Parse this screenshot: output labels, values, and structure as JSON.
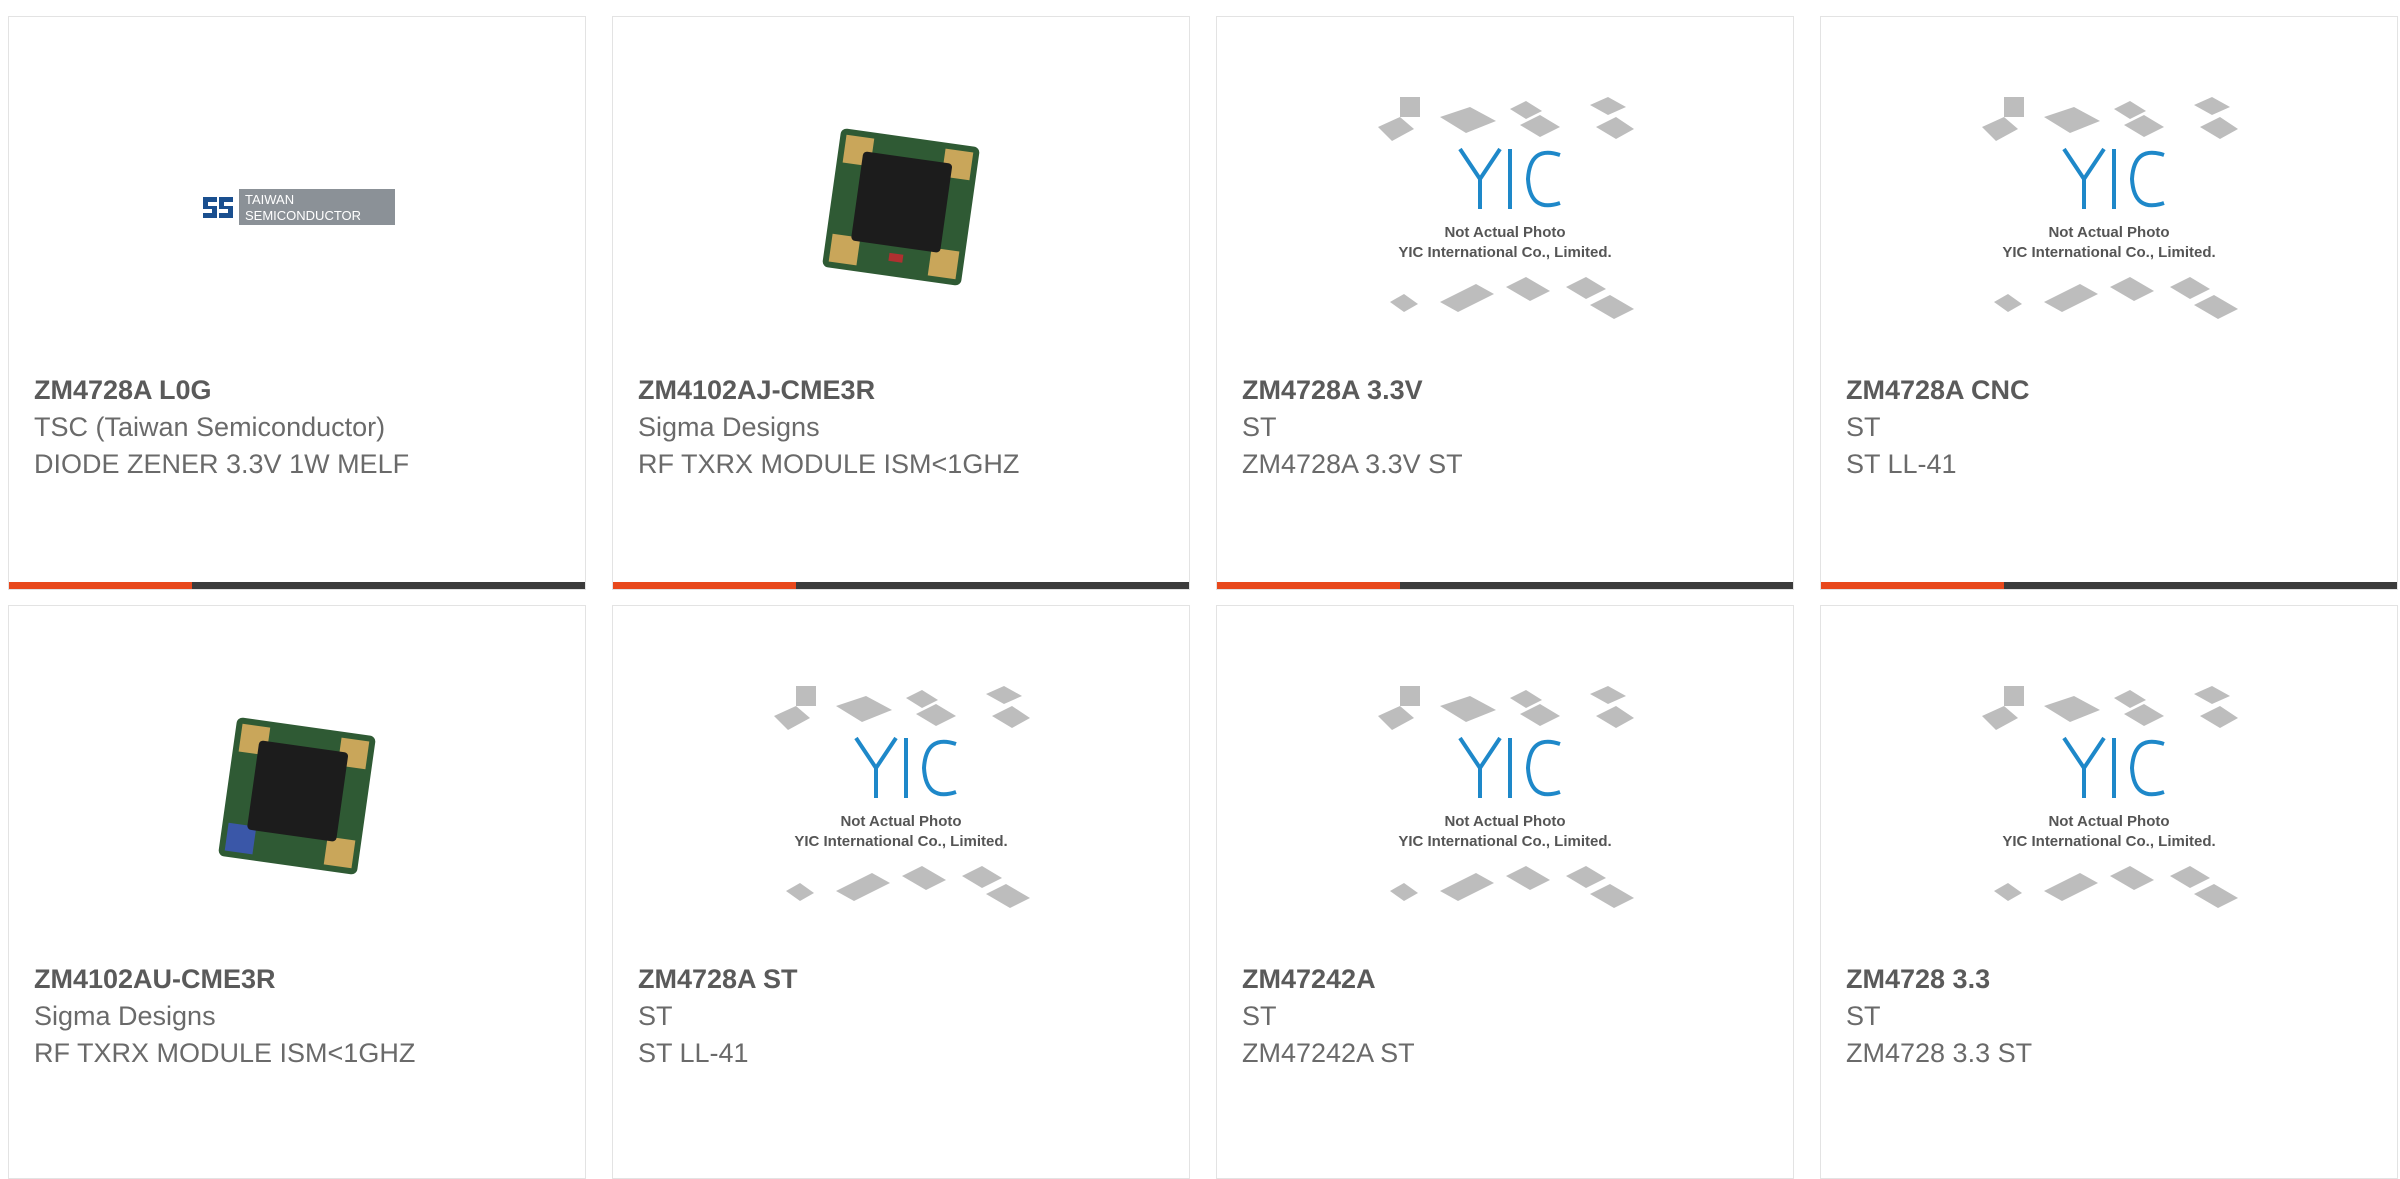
{
  "colors": {
    "accent": "#e8481c",
    "bar": "#3b3b3b",
    "text_bold": "#5a5a5a",
    "text": "#6a6a6a"
  },
  "placeholder": {
    "line1": "Not Actual Photo",
    "line2": "YIC International Co., Limited."
  },
  "logo_tsc": {
    "line1": "TAIWAN",
    "line2": "SEMICONDUCTOR"
  },
  "products": [
    {
      "part": "ZM4728A L0G",
      "manufacturer": "TSC (Taiwan Semiconductor)",
      "description": "DIODE ZENER 3.3V 1W MELF",
      "image": "taiwan-semiconductor-logo"
    },
    {
      "part": "ZM4102AJ-CME3R",
      "manufacturer": "Sigma Designs",
      "description": "RF TXRX MODULE ISM<1GHZ",
      "image": "rf-module-photo"
    },
    {
      "part": "ZM4728A 3.3V",
      "manufacturer": "ST",
      "description": "ZM4728A 3.3V ST",
      "image": "yic-placeholder"
    },
    {
      "part": "ZM4728A CNC",
      "manufacturer": "ST",
      "description": "ST LL-41",
      "image": "yic-placeholder"
    },
    {
      "part": "ZM4102AU-CME3R",
      "manufacturer": "Sigma Designs",
      "description": "RF TXRX MODULE ISM<1GHZ",
      "image": "rf-module-photo"
    },
    {
      "part": "ZM4728A ST",
      "manufacturer": "ST",
      "description": "ST LL-41",
      "image": "yic-placeholder"
    },
    {
      "part": "ZM47242A",
      "manufacturer": "ST",
      "description": "ZM47242A ST",
      "image": "yic-placeholder"
    },
    {
      "part": "ZM4728 3.3",
      "manufacturer": "ST",
      "description": "ZM4728 3.3 ST",
      "image": "yic-placeholder"
    }
  ]
}
